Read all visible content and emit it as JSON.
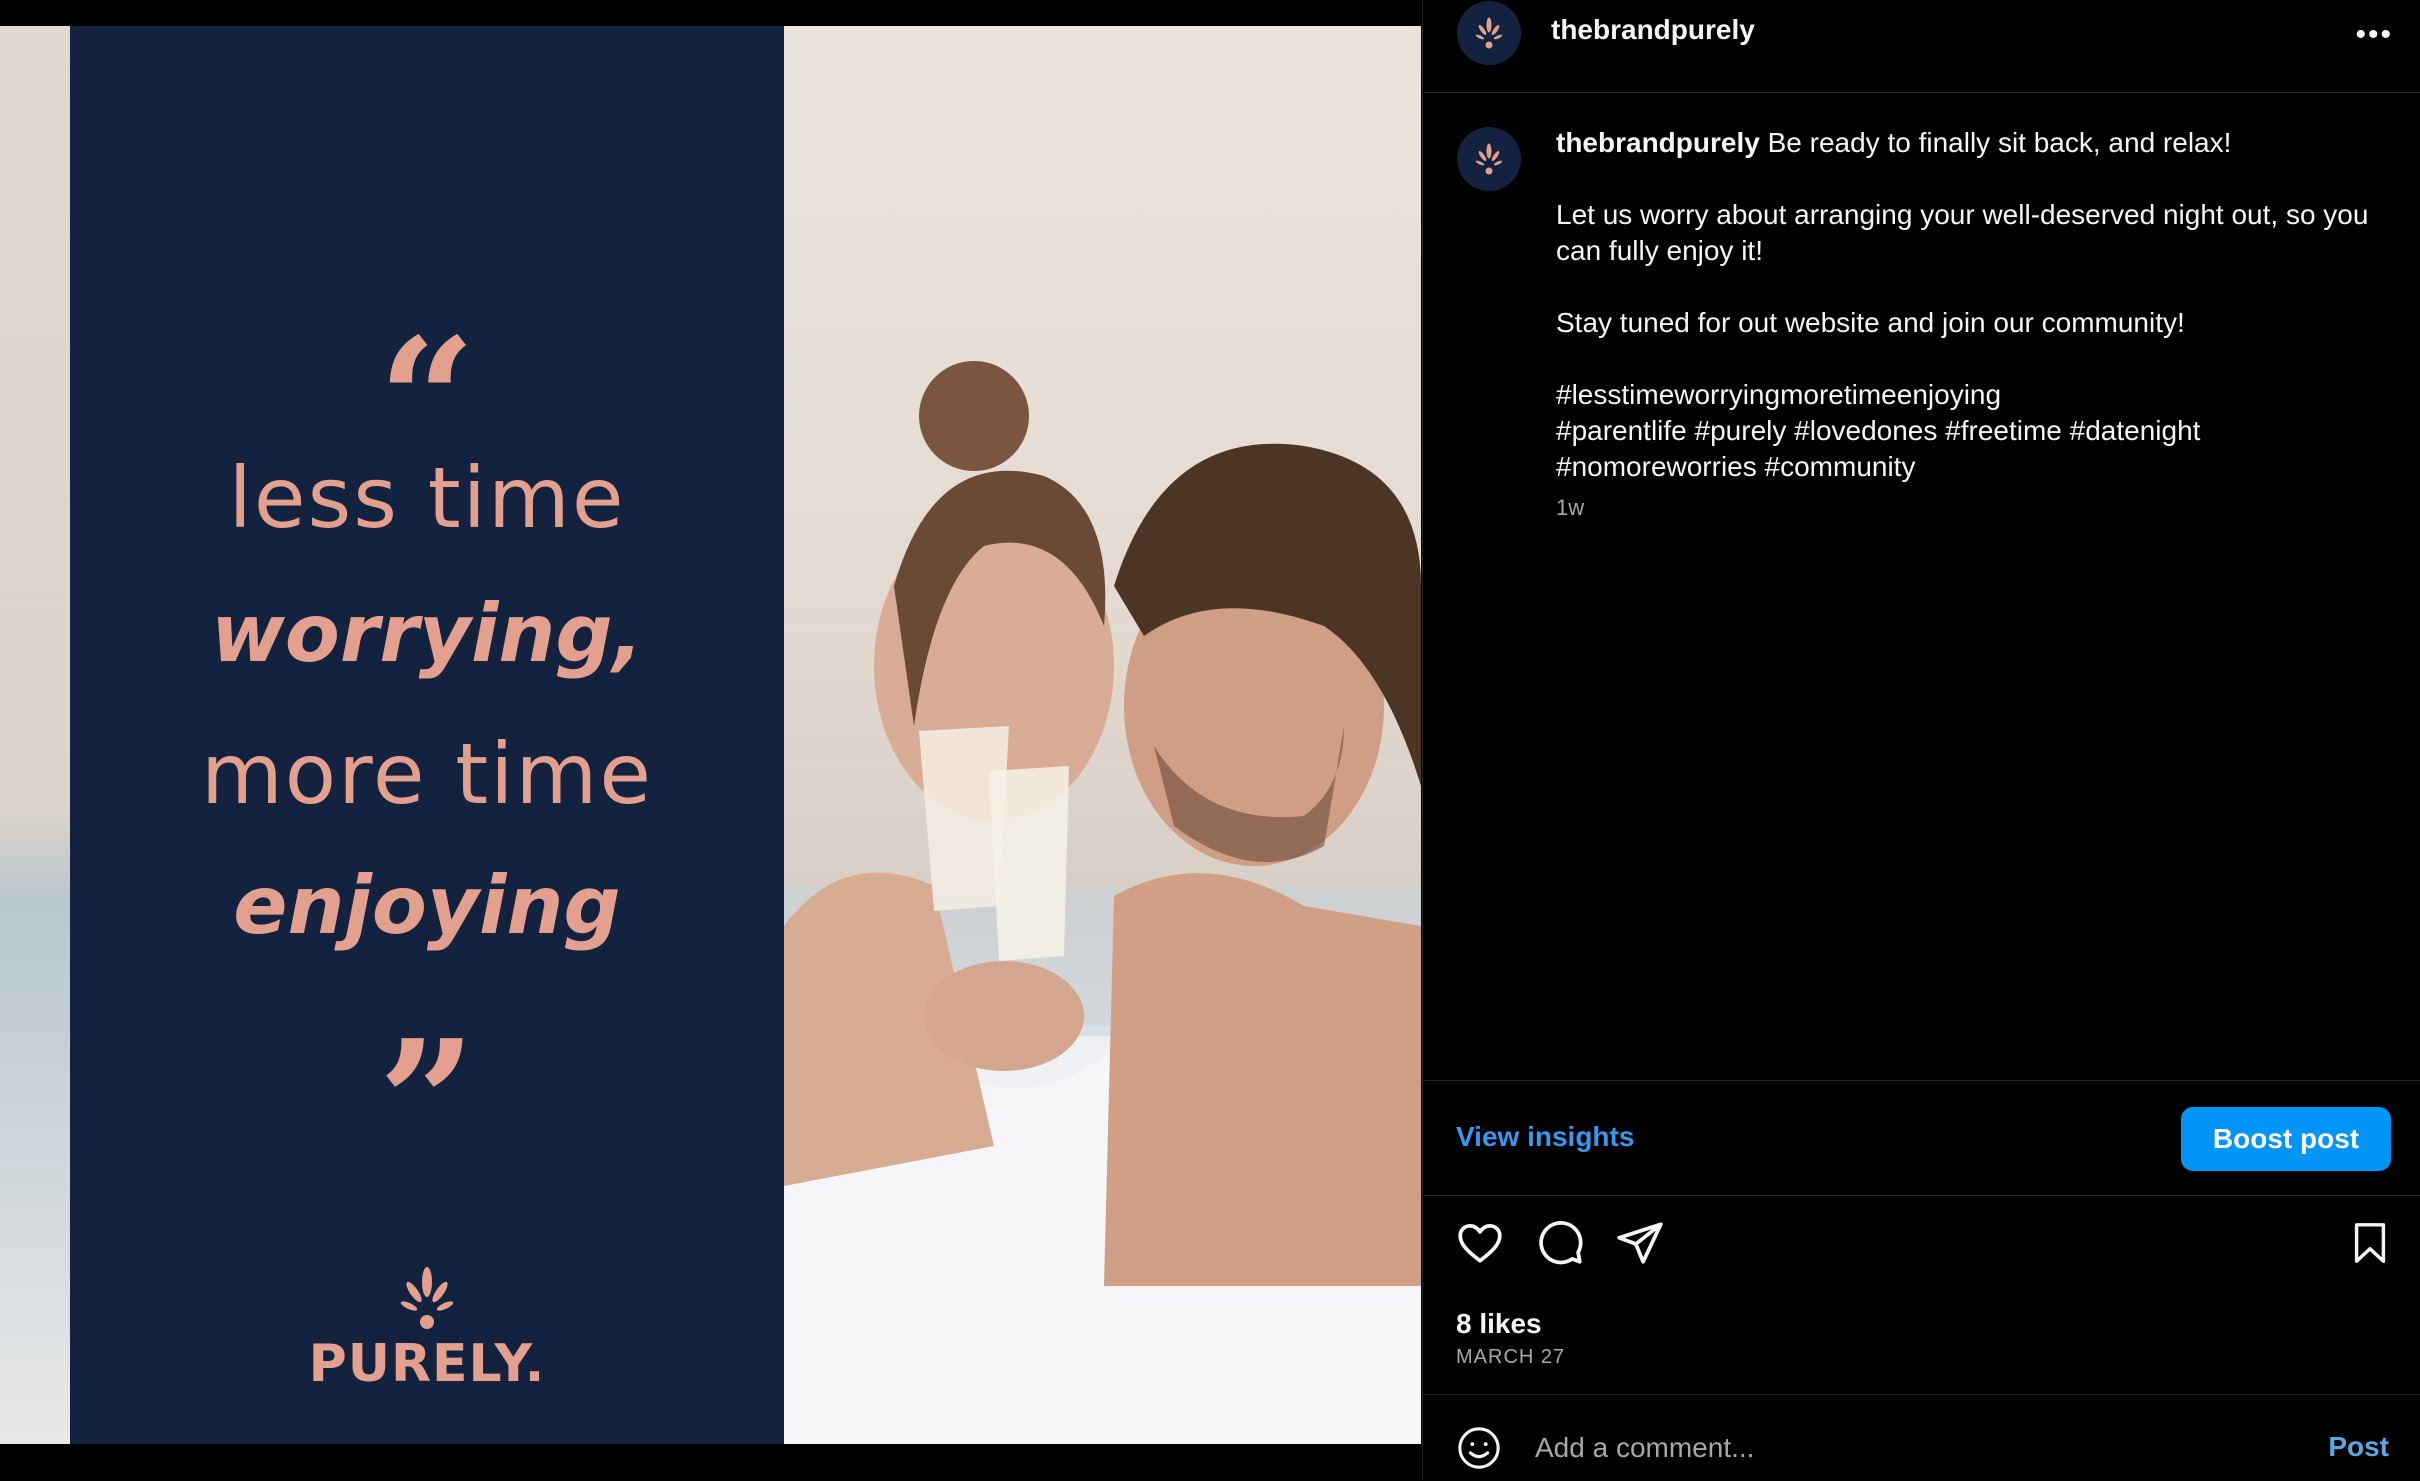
{
  "post_image": {
    "quote_open": "“",
    "quote_close": "”",
    "line1": "less time",
    "line2": "worrying,",
    "line3": "more time",
    "line4": "enjoying",
    "brand_name": "PURELY."
  },
  "header": {
    "username": "thebrandpurely",
    "more_icon": "more-horizontal-icon"
  },
  "caption": {
    "username": "thebrandpurely",
    "first_line": "Be ready to finally sit back, and relax!",
    "paragraph2": "Let us worry about arranging your well-deserved night out, so you can fully enjoy it!",
    "paragraph3": "Stay tuned for out website and join our community!",
    "hashtags_line1": "#lesstimeworryingmoretimeenjoying",
    "hashtags_line2": "#parentlife #purely #lovedones #freetime #datenight",
    "hashtags_line3": "#nomoreworries #community",
    "time_ago": "1w"
  },
  "insights": {
    "view_label": "View insights",
    "boost_label": "Boost post"
  },
  "actions": {
    "icons": [
      "heart-icon",
      "comment-icon",
      "share-icon",
      "bookmark-icon"
    ]
  },
  "stats": {
    "likes": "8 likes",
    "date": "MARCH 27"
  },
  "comment": {
    "placeholder": "Add a comment...",
    "post_label": "Post"
  },
  "colors": {
    "navy": "#13233f",
    "peach": "#e3a08e",
    "accent_blue": "#0095f6",
    "link_blue": "#3897f0"
  }
}
